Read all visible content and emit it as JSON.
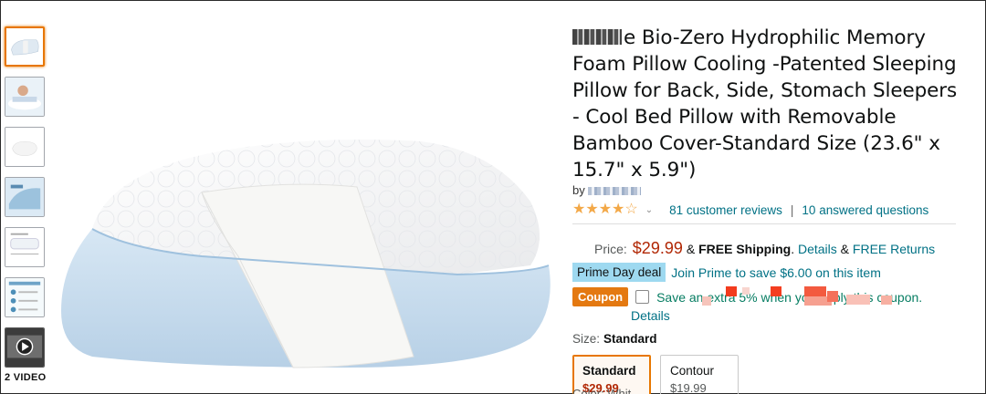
{
  "product": {
    "title_rest": "e Bio-Zero Hydrophilic Memory Foam Pillow Cooling -Patented Sleeping Pillow for Back, Side, Stomach Sleepers - Cool Bed Pillow with Removable Bamboo Cover-Standard Size (23.6\" x 15.7\" x 5.9\")",
    "by_prefix": "by",
    "rating_stars": 4,
    "reviews_link": "81 customer reviews",
    "separator": "|",
    "questions_link": "10 answered questions"
  },
  "pricing": {
    "label": "Price:",
    "price": "$29.99",
    "shipping_prefix": "& ",
    "shipping_bold": "FREE Shipping",
    "shipping_mid": ". ",
    "details_link": "Details",
    "amp": " & ",
    "returns_link": "FREE Returns"
  },
  "deal": {
    "badge": "Prime Day deal",
    "text": "Join Prime to save $6.00 on this item"
  },
  "coupon": {
    "badge": "Coupon",
    "text": "Save an extra 5% when you apply this coupon.",
    "details_link": "Details"
  },
  "size": {
    "label": "Size:",
    "value": "Standard",
    "options": [
      {
        "name": "Standard",
        "price": "$29.99",
        "selected": true
      },
      {
        "name": "Contour",
        "price": "$19.99",
        "selected": false
      }
    ]
  },
  "gallery": {
    "video_label": "2 VIDEO"
  },
  "partial": {
    "color_label": "Color: Whit"
  },
  "colors": {
    "accent_orange": "#e77600",
    "price_red": "#b12704",
    "link_teal": "#007185",
    "deal_blue": "#9ed9f0",
    "coupon_orange": "#e47911",
    "coupon_green": "#067d62",
    "star": "#f3a847"
  }
}
